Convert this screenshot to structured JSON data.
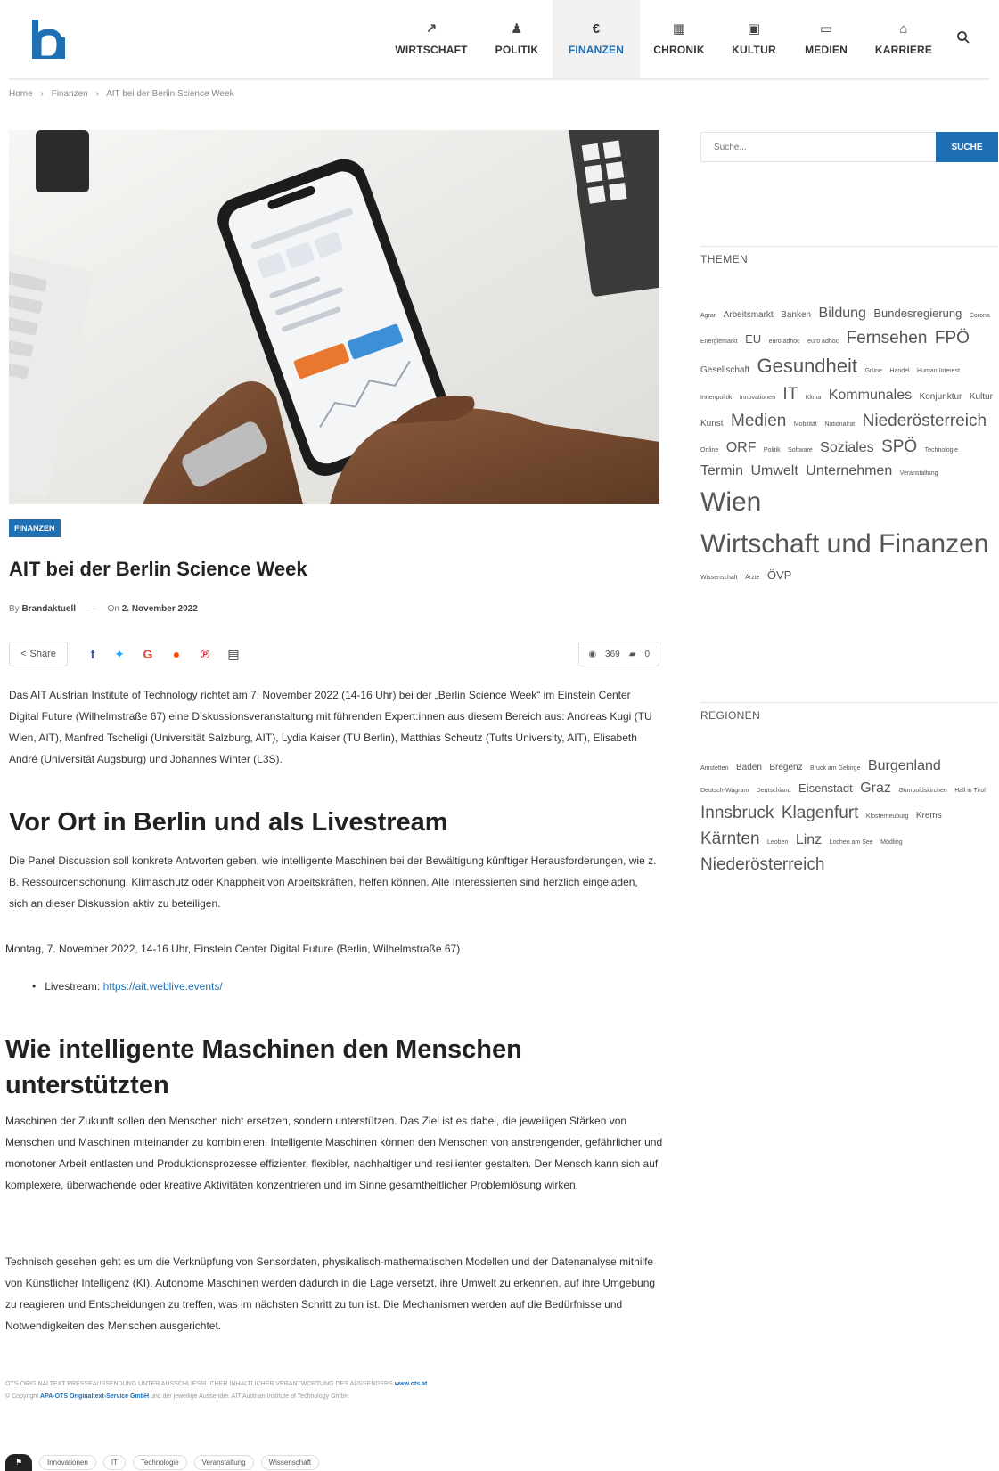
{
  "header": {
    "nav": [
      {
        "label": "WIRTSCHAFT",
        "icon": "chart-line-icon",
        "glyph": "↗"
      },
      {
        "label": "POLITIK",
        "icon": "people-icon",
        "glyph": "♟"
      },
      {
        "label": "FINANZEN",
        "icon": "euro-icon",
        "glyph": "€"
      },
      {
        "label": "CHRONIK",
        "icon": "calendar-icon",
        "glyph": "▦"
      },
      {
        "label": "KULTUR",
        "icon": "image-icon",
        "glyph": "▣"
      },
      {
        "label": "MEDIEN",
        "icon": "monitor-icon",
        "glyph": "▭"
      },
      {
        "label": "KARRIERE",
        "icon": "building-icon",
        "glyph": "⌂"
      }
    ],
    "active_nav": "FINANZEN",
    "accent_color": "#1f6fb5"
  },
  "breadcrumb": [
    "Home",
    "›",
    "Finanzen",
    "›",
    "AIT bei der Berlin Science Week"
  ],
  "article": {
    "category": "FINANZEN",
    "title": "AIT bei der Berlin Science Week",
    "meta_by": "By",
    "author": "Brandaktuell",
    "meta_on": "On",
    "date": "2. November 2022",
    "share_label": "Share",
    "views": "369",
    "comments": "0",
    "intro": "Das AIT Austrian Institute of Technology richtet am 7. November 2022 (14-16 Uhr) bei der „Berlin Science Week“ im Einstein Center Digital Future (Wilhelmstraße 67) eine Diskussionsveranstaltung mit führenden Expert:innen aus diesem Bereich aus: Andreas Kugi (TU Wien, AIT), Manfred Tscheligi (Universität Salzburg, AIT), Lydia Kaiser (TU Berlin), Matthias Scheutz (Tufts University, AIT), Elisabeth André (Universität Augsburg) und Johannes Winter (L3S).",
    "h2_1": "Vor Ort in Berlin und als Livestream",
    "p2": "Die Panel Discussion soll konkrete Antworten geben, wie intelligente Maschinen bei der Bewältigung künftiger Herausforderungen, wie z. B. Ressourcenschonung, Klimaschutz oder Knappheit von Arbeitskräften, helfen können. Alle Interessierten sind herzlich eingeladen, sich an dieser Diskussion aktiv zu beteiligen.",
    "event_line": "Montag, 7. November 2022, 14-16 Uhr, Einstein Center Digital Future (Berlin, Wilhelmstraße 67)",
    "livestream_label": "Livestream:",
    "livestream_url": "https://ait.weblive.events/",
    "h2_2": "Wie intelligente Maschinen den Menschen unterstützten",
    "p3": "Maschinen der Zukunft sollen den Menschen nicht ersetzen, sondern unterstützen. Das Ziel ist es dabei, die jeweiligen Stärken von Menschen und Maschinen miteinander zu kombinieren. Intelligente Maschinen können den Menschen von anstrengender, gefährlicher und monotoner Arbeit entlasten und Produktionsprozesse effizienter, flexibler, nachhaltiger und resilienter gestalten. Der Mensch kann sich auf komplexere, überwachende oder kreative Aktivitäten konzentrieren und im Sinne gesamtheitlicher Problemlösung wirken.",
    "p4": "Technisch gesehen geht es um die Verknüpfung von Sensordaten, physikalisch-mathematischen Modellen und der Datenanalyse mithilfe von Künstlicher Intelligenz (KI). Autonome Maschinen werden dadurch in die Lage versetzt, ihre Umwelt zu erkennen, auf ihre Umgebung zu reagieren und Entscheidungen zu treffen, was im nächsten Schritt zu tun ist. Die Mechanismen werden auf die Bedürfnisse und Notwendigkeiten des Menschen ausgerichtet.",
    "footnote_1": "OTS-ORIGINALTEXT PRESSEAUSSENDUNG UNTER AUSSCHLIESSLICHER INHALTLICHER VERANTWORTUNG DES AUSSENDERS",
    "footnote_link": "www.ots.at",
    "footnote_2a": "© Copyright",
    "footnote_2b": "APA-OTS Originaltext-Service GmbH",
    "footnote_2c": "und der jeweilige Aussender. AIT Austrian Institute of Technology GmbH",
    "tags": [
      "Innovationen",
      "IT",
      "Technologie",
      "Veranstaltung",
      "Wissenschaft"
    ]
  },
  "sidebar": {
    "search_placeholder": "Suche...",
    "search_button": "SUCHE",
    "themen_title": "THEMEN",
    "themen": [
      {
        "t": "Agrar",
        "s": 1
      },
      {
        "t": "Arbeitsmarkt",
        "s": 2
      },
      {
        "t": "Banken",
        "s": 2
      },
      {
        "t": "Bildung",
        "s": 4
      },
      {
        "t": "Bundesregierung",
        "s": 3
      },
      {
        "t": "Corona",
        "s": 1
      },
      {
        "t": "Energiemarkt",
        "s": 1
      },
      {
        "t": "EU",
        "s": 3
      },
      {
        "t": "euro adhoc",
        "s": 1
      },
      {
        "t": "euro adhoc",
        "s": 1
      },
      {
        "t": "Fernsehen",
        "s": 5
      },
      {
        "t": "FPÖ",
        "s": 5
      },
      {
        "t": "Gesellschaft",
        "s": 2
      },
      {
        "t": "Gesundheit",
        "s": 6
      },
      {
        "t": "Grüne",
        "s": 1
      },
      {
        "t": "Handel",
        "s": 1
      },
      {
        "t": "Human Interest",
        "s": 1
      },
      {
        "t": "Innenpolitik",
        "s": 1
      },
      {
        "t": "Innovationen",
        "s": 1
      },
      {
        "t": "IT",
        "s": 5
      },
      {
        "t": "Klima",
        "s": 1
      },
      {
        "t": "Kommunales",
        "s": 4
      },
      {
        "t": "Konjunktur",
        "s": 2
      },
      {
        "t": "Kultur",
        "s": 2
      },
      {
        "t": "Kunst",
        "s": 2
      },
      {
        "t": "Medien",
        "s": 5
      },
      {
        "t": "Mobilität",
        "s": 1
      },
      {
        "t": "Nationalrat",
        "s": 1
      },
      {
        "t": "Niederösterreich",
        "s": 5
      },
      {
        "t": "Online",
        "s": 1
      },
      {
        "t": "ORF",
        "s": 4
      },
      {
        "t": "Politik",
        "s": 1
      },
      {
        "t": "Software",
        "s": 1
      },
      {
        "t": "Soziales",
        "s": 4
      },
      {
        "t": "SPÖ",
        "s": 5
      },
      {
        "t": "Technologie",
        "s": 1
      },
      {
        "t": "Termin",
        "s": 4
      },
      {
        "t": "Umwelt",
        "s": 4
      },
      {
        "t": "Unternehmen",
        "s": 4
      },
      {
        "t": "Veranstaltung",
        "s": 1
      },
      {
        "t": "Wien",
        "s": 7
      },
      {
        "t": "Wirtschaft und Finanzen",
        "s": 7
      },
      {
        "t": "Wissenschaft",
        "s": 1
      },
      {
        "t": "Ärzte",
        "s": 1
      },
      {
        "t": "ÖVP",
        "s": 3
      }
    ],
    "regionen_title": "REGIONEN",
    "regionen": [
      {
        "t": "Amstetten",
        "s": 1
      },
      {
        "t": "Baden",
        "s": 2
      },
      {
        "t": "Bregenz",
        "s": 2
      },
      {
        "t": "Bruck am Gebirge",
        "s": 1
      },
      {
        "t": "Burgenland",
        "s": 4
      },
      {
        "t": "Deutsch-Wagram",
        "s": 1
      },
      {
        "t": "Deutschland",
        "s": 1
      },
      {
        "t": "Eisenstadt",
        "s": 3
      },
      {
        "t": "Graz",
        "s": 4
      },
      {
        "t": "Gumpoldskirchen",
        "s": 1
      },
      {
        "t": "Hall in Tirol",
        "s": 1
      },
      {
        "t": "Innsbruck",
        "s": 5
      },
      {
        "t": "Klagenfurt",
        "s": 5
      },
      {
        "t": "Klosterneuburg",
        "s": 1
      },
      {
        "t": "Krems",
        "s": 2
      },
      {
        "t": "Kärnten",
        "s": 5
      },
      {
        "t": "Leoben",
        "s": 1
      },
      {
        "t": "Linz",
        "s": 4
      },
      {
        "t": "Lochen am See",
        "s": 1
      },
      {
        "t": "Mödling",
        "s": 1
      },
      {
        "t": "Niederösterreich",
        "s": 5
      }
    ]
  }
}
